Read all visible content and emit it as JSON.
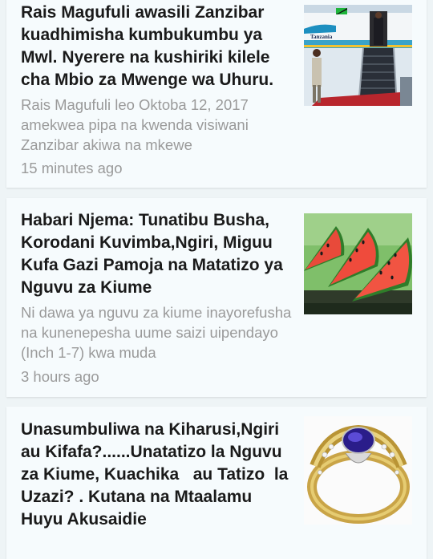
{
  "articles": [
    {
      "title": "Rais Magufuli awasili Zanzibar kuadhimisha kumbukumbu ya Mwl. Nyerere na kushiriki kilele cha Mbio za Mwenge wa Uhuru.",
      "summary": "Rais Magufuli leo Oktoba 12, 2017 amekwea pipa na kwenda visiwani Zanzibar akiwa na mkewe",
      "time": "15 minutes ago",
      "thumbnail": {
        "icon": "airplane-arrival-photo",
        "caption": "Tanzania"
      }
    },
    {
      "title": "Habari Njema: Tunatibu Busha, Korodani Kuvimba,Ngiri, Miguu Kufa Gazi Pamoja na Matatizo ya Nguvu za Kiume",
      "summary": "Ni dawa ya nguvu za kiume inayorefusha na kunenepesha uume saizi uipendayo (Inch 1-7) kwa muda",
      "time": "3 hours ago",
      "thumbnail": {
        "icon": "watermelon-photo"
      }
    },
    {
      "title": "Unasumbuliwa na Kiharusi,Ngiri  au Kifafa?......Unatatizo la Nguvu za Kiume, Kuachika   au Tatizo  la  Uzazi? . Kutana na Mtaalamu Huyu Akusaidie",
      "thumbnail": {
        "icon": "gemstone-ring-photo"
      }
    }
  ]
}
